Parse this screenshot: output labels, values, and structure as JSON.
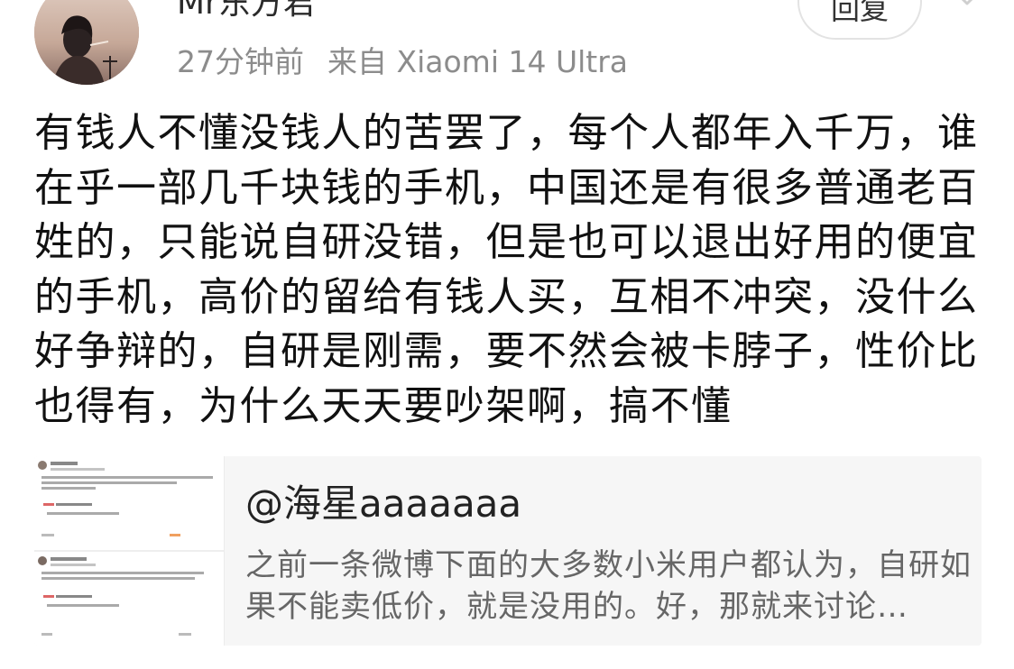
{
  "post": {
    "username": "Mr东方君",
    "time": "27分钟前",
    "source": "来自 Xiaomi 14 Ultra",
    "reply_label": "回复",
    "body": "有钱人不懂没钱人的苦罢了，每个人都年入千万，谁在乎一部几千块钱的手机，中国还是有很多普通老百姓的，只能说自研没错，但是也可以退出好用的便宜的手机，高价的留给有钱人买，互相不冲突，没什么好争辩的，自研是刚需，要不然会被卡脖子，性价比也得有，为什么天天要吵架啊，搞不懂"
  },
  "quote": {
    "author": "@海星aaaaaaa",
    "text": "之前一条微博下面的大多数小米用户都认为，自研如果不能卖低价，就是没用的。好，那就来讨论…"
  },
  "icons": {
    "avatar": "user-avatar",
    "more": "chevron-down-icon",
    "thumbnail": "post-screenshot-thumbnail"
  },
  "colors": {
    "meta_text": "#8c8c8c",
    "quote_bg": "#f6f6f6",
    "quote_text": "#666666"
  }
}
